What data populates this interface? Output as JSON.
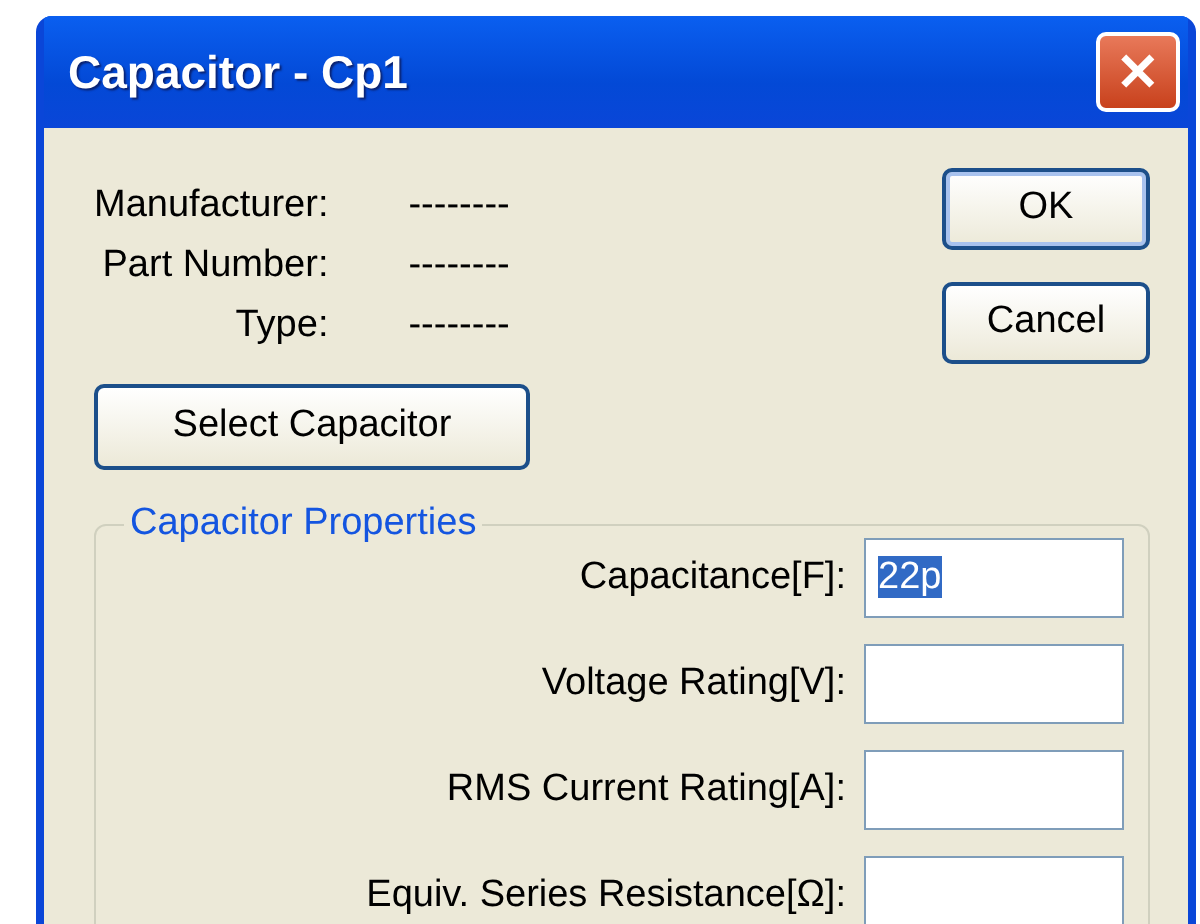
{
  "window": {
    "title": "Capacitor - Cp1",
    "close_label": "✕"
  },
  "info": [
    {
      "label": "Manufacturer:",
      "value": "--------"
    },
    {
      "label": "Part Number:",
      "value": "--------"
    },
    {
      "label": "Type:",
      "value": "--------"
    }
  ],
  "select_button": "Select Capacitor",
  "buttons": [
    {
      "label": "OK",
      "default": true
    },
    {
      "label": "Cancel",
      "default": false
    }
  ],
  "group": {
    "title": "Capacitor Properties",
    "fields": [
      {
        "label": "Capacitance[F]:",
        "value": "22p",
        "text_selected": true
      },
      {
        "label": "Voltage Rating[V]:"
      },
      {
        "label": "RMS Current Rating[A]:"
      },
      {
        "label": "Equiv. Series Resistance[Ω]:"
      }
    ]
  }
}
